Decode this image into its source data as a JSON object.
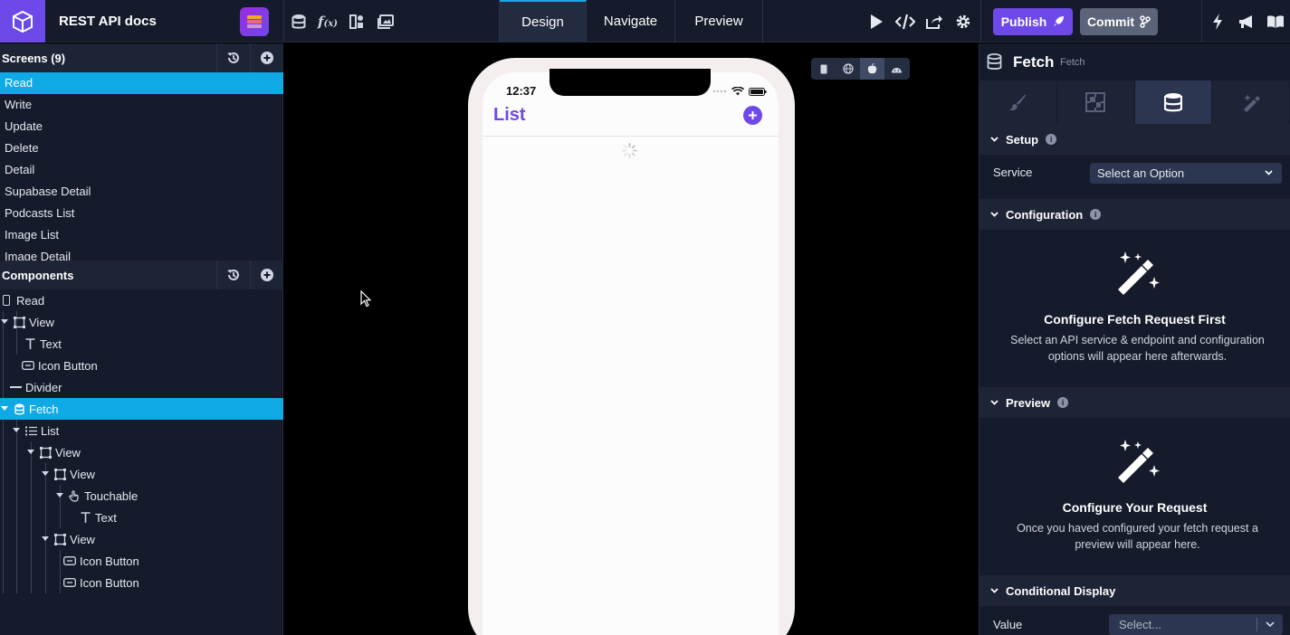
{
  "app": {
    "title": "REST API docs"
  },
  "tabs": [
    {
      "label": "Design",
      "active": true
    },
    {
      "label": "Navigate",
      "active": false
    },
    {
      "label": "Preview",
      "active": false
    }
  ],
  "header_actions": {
    "publish": "Publish",
    "commit": "Commit"
  },
  "screens_panel": {
    "title": "Screens (9)",
    "items": [
      "Read",
      "Write",
      "Update",
      "Delete",
      "Detail",
      "Supabase Detail",
      "Podcasts List",
      "Image List",
      "Image Detail"
    ],
    "selected": "Read"
  },
  "components_panel": {
    "title": "Components",
    "items": [
      {
        "label": "Read",
        "icon": "screen-icon"
      },
      {
        "label": "View",
        "icon": "view-icon"
      },
      {
        "label": "Text",
        "icon": "text-icon"
      },
      {
        "label": "Icon Button",
        "icon": "icon-button-icon"
      },
      {
        "label": "Divider",
        "icon": "divider-icon"
      },
      {
        "label": "Fetch",
        "icon": "database-icon",
        "selected": true
      },
      {
        "label": "List",
        "icon": "list-icon"
      },
      {
        "label": "View",
        "icon": "view-icon"
      },
      {
        "label": "View",
        "icon": "view-icon"
      },
      {
        "label": "Touchable",
        "icon": "touch-icon"
      },
      {
        "label": "Text",
        "icon": "text-icon"
      },
      {
        "label": "View",
        "icon": "view-icon"
      },
      {
        "label": "Icon Button",
        "icon": "icon-button-icon"
      },
      {
        "label": "Icon Button",
        "icon": "icon-button-icon"
      }
    ]
  },
  "device": {
    "time": "12:37",
    "screen_title": "List"
  },
  "inspector": {
    "title": "Fetch",
    "subtitle": "Fetch",
    "setup": {
      "heading": "Setup",
      "service_label": "Service",
      "service_value": "Select an Option"
    },
    "configuration": {
      "heading": "Configuration",
      "empty_title": "Configure Fetch Request First",
      "empty_text": "Select an API service & endpoint and configuration options will appear here afterwards."
    },
    "preview": {
      "heading": "Preview",
      "empty_title": "Configure Your Request",
      "empty_text": "Once you haved configured your fetch request a preview will appear here."
    },
    "conditional": {
      "heading": "Conditional Display",
      "value_label": "Value",
      "value_placeholder": "Select..."
    }
  },
  "colors": {
    "accent": "#6e49e9",
    "selection": "#0fa9e6",
    "panel": "#151b2b"
  }
}
